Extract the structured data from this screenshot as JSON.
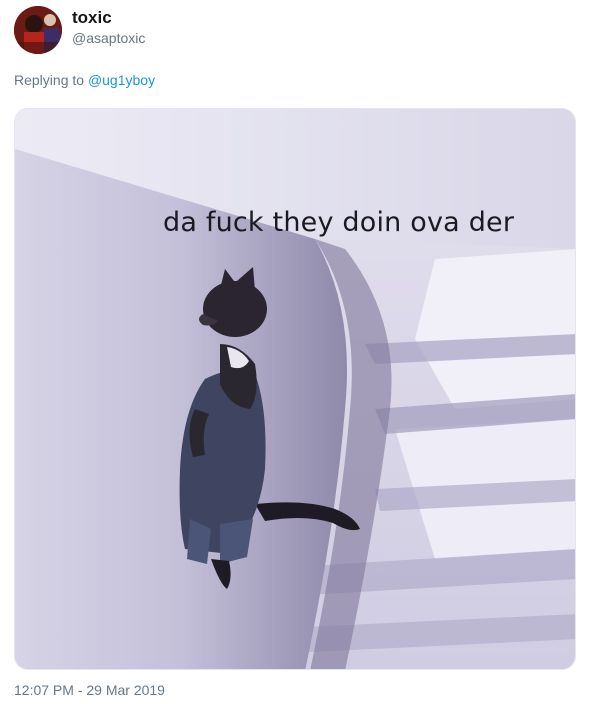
{
  "tweet": {
    "display_name": "toxic",
    "handle": "@asaptoxic",
    "replying_prefix": "Replying to",
    "replying_to": "@ug1yboy",
    "media": {
      "caption": "da fuck they doin ova der",
      "icon": "cat-peeking-around-snow-wall-photo"
    },
    "timestamp": "12:07 PM - 29 Mar 2019"
  },
  "colors": {
    "link": "#1b95e0",
    "secondary_text": "#657786",
    "primary_text": "#14171a"
  }
}
